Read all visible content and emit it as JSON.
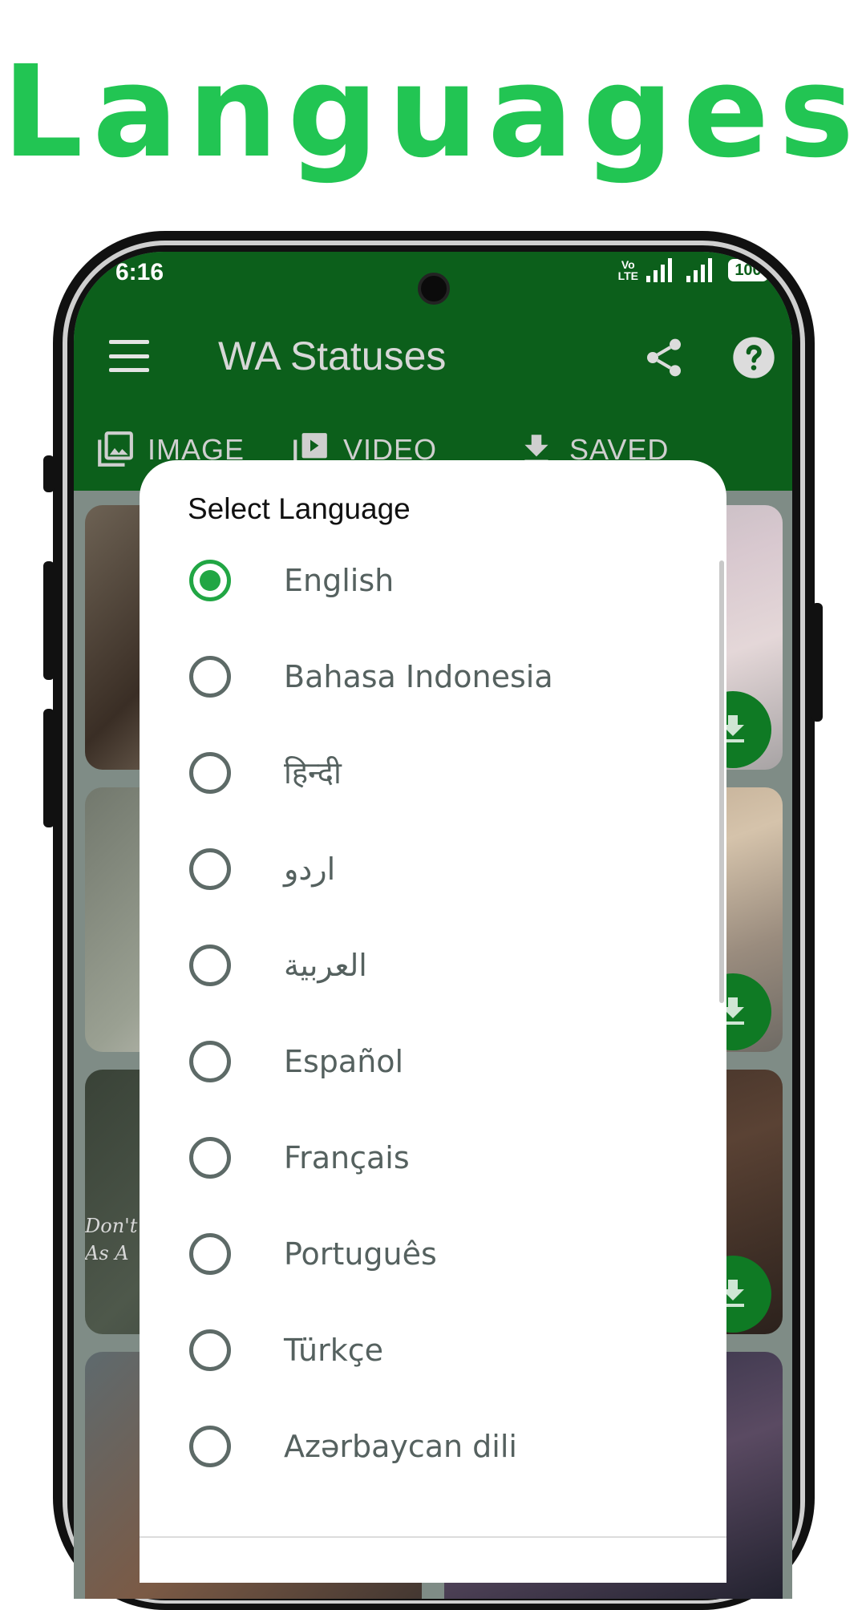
{
  "headline": "Languages",
  "colors": {
    "accent": "#22c553",
    "appbar": "#0c5f1b",
    "radio_selected": "#21a644"
  },
  "status_bar": {
    "time": "6:16",
    "volte_top": "Vo",
    "volte_bottom": "LTE",
    "battery": "100"
  },
  "appbar": {
    "title": "WA Statuses",
    "menu_icon": "hamburger-menu-icon",
    "share_icon": "share-icon",
    "help_icon": "help-icon"
  },
  "tabs": [
    {
      "label": "IMAGE",
      "icon": "image-icon"
    },
    {
      "label": "VIDEO",
      "icon": "video-icon"
    },
    {
      "label": "SAVED",
      "icon": "download-icon"
    }
  ],
  "grid": {
    "overlay_text": "Don't\nAs A"
  },
  "dialog": {
    "title": "Select Language",
    "selected": "English",
    "options": [
      {
        "label": "English"
      },
      {
        "label": "Bahasa Indonesia"
      },
      {
        "label": "हिन्दी"
      },
      {
        "label": "اردو"
      },
      {
        "label": "العربية"
      },
      {
        "label": "Español"
      },
      {
        "label": "Français"
      },
      {
        "label": "Português"
      },
      {
        "label": "Türkçe"
      },
      {
        "label": "Azərbaycan dili"
      }
    ]
  }
}
